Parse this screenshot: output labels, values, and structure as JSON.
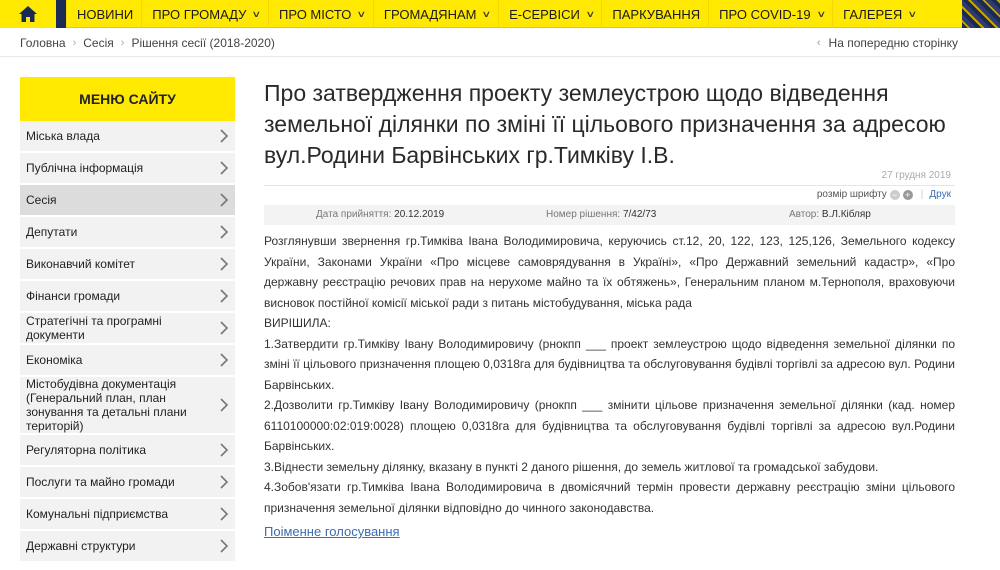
{
  "nav": {
    "items": [
      {
        "label": "НОВИНИ",
        "has_dropdown": false
      },
      {
        "label": "ПРО ГРОМАДУ",
        "has_dropdown": true
      },
      {
        "label": "ПРО МІСТО",
        "has_dropdown": true
      },
      {
        "label": "ГРОМАДЯНАМ",
        "has_dropdown": true
      },
      {
        "label": "Е-СЕРВІСИ",
        "has_dropdown": true
      },
      {
        "label": "ПАРКУВАННЯ",
        "has_dropdown": false
      },
      {
        "label": "ПРО COVID-19",
        "has_dropdown": true
      },
      {
        "label": "ГАЛЕРЕЯ",
        "has_dropdown": true
      }
    ],
    "accent_color": "#ffe900"
  },
  "breadcrumb": {
    "items": [
      "Головна",
      "Сесія",
      "Рішення сесії (2018-2020)"
    ],
    "back_label": "На попередню сторінку"
  },
  "sidebar": {
    "title": "МЕНЮ САЙТУ",
    "items": [
      {
        "label": "Міська влада"
      },
      {
        "label": "Публічна інформація"
      },
      {
        "label": "Сесія",
        "active": true
      },
      {
        "label": "Депутати"
      },
      {
        "label": "Виконавчий комітет"
      },
      {
        "label": "Фінанси громади"
      },
      {
        "label": "Стратегічні та програмні документи"
      },
      {
        "label": "Економіка"
      },
      {
        "label": "Містобудівна документація (Генеральний план, план зонування та детальні плани територій)"
      },
      {
        "label": "Регуляторна політика"
      },
      {
        "label": "Послуги та майно громади"
      },
      {
        "label": "Комунальні підприємства"
      },
      {
        "label": "Державні структури"
      }
    ]
  },
  "article": {
    "title": "Про затвердження проекту землеустрою щодо відведення земельної ділянки по зміні її цільового призначення за адресою вул.Родини Барвінських гр.Тимківу І.В.",
    "date": "27 грудня 2019",
    "font_size_label": "розмір шрифту",
    "print_label": "Друк",
    "meta": {
      "adopted_label": "Дата прийняття:",
      "adopted_value": "20.12.2019",
      "number_label": "Номер рішення:",
      "number_value": "7/42/73",
      "author_label": "Автор:",
      "author_value": "В.Л.Кібляр"
    },
    "paragraphs": [
      "Розглянувши звернення гр.Тимківа Івана Володимировича, керуючись ст.12, 20, 122, 123, 125,126, Земельного кодексу України, Законами України «Про місцеве самоврядування в Україні», «Про Державний земельний кадастр», «Про державну реєстрацію речових прав на нерухоме майно та їх обтяжень», Генеральним планом м.Тернополя, враховуючи висновок постійної комісії міської ради з питань містобудування, міська рада",
      "ВИРІШИЛА:",
      "1.Затвердити гр.Тимківу Івану Володимировичу (рнокпп ___ проект землеустрою щодо відведення земельної ділянки по зміні її цільового призначення площею 0,0318га для будівництва та обслуговування будівлі торгівлі за адресою вул. Родини Барвінських.",
      "2.Дозволити гр.Тимківу Івану Володимировичу (рнокпп ___ змінити цільове призначення земельної ділянки (кад. номер 6110100000:02:019:0028) площею 0,0318га для будівництва та обслуговування будівлі торгівлі за адресою вул.Родини Барвінських.",
      "3.Віднести земельну ділянку, вказану в пункті 2 даного рішення, до земель житлової та громадської забудови.",
      "4.Зобов'язати гр.Тимківа Івана Володимировича в двомісячний термін провести державну реєстрацію зміни цільового призначення земельної ділянки відповідно до чинного законодавства."
    ],
    "vote_link": "Поіменне голосування"
  }
}
